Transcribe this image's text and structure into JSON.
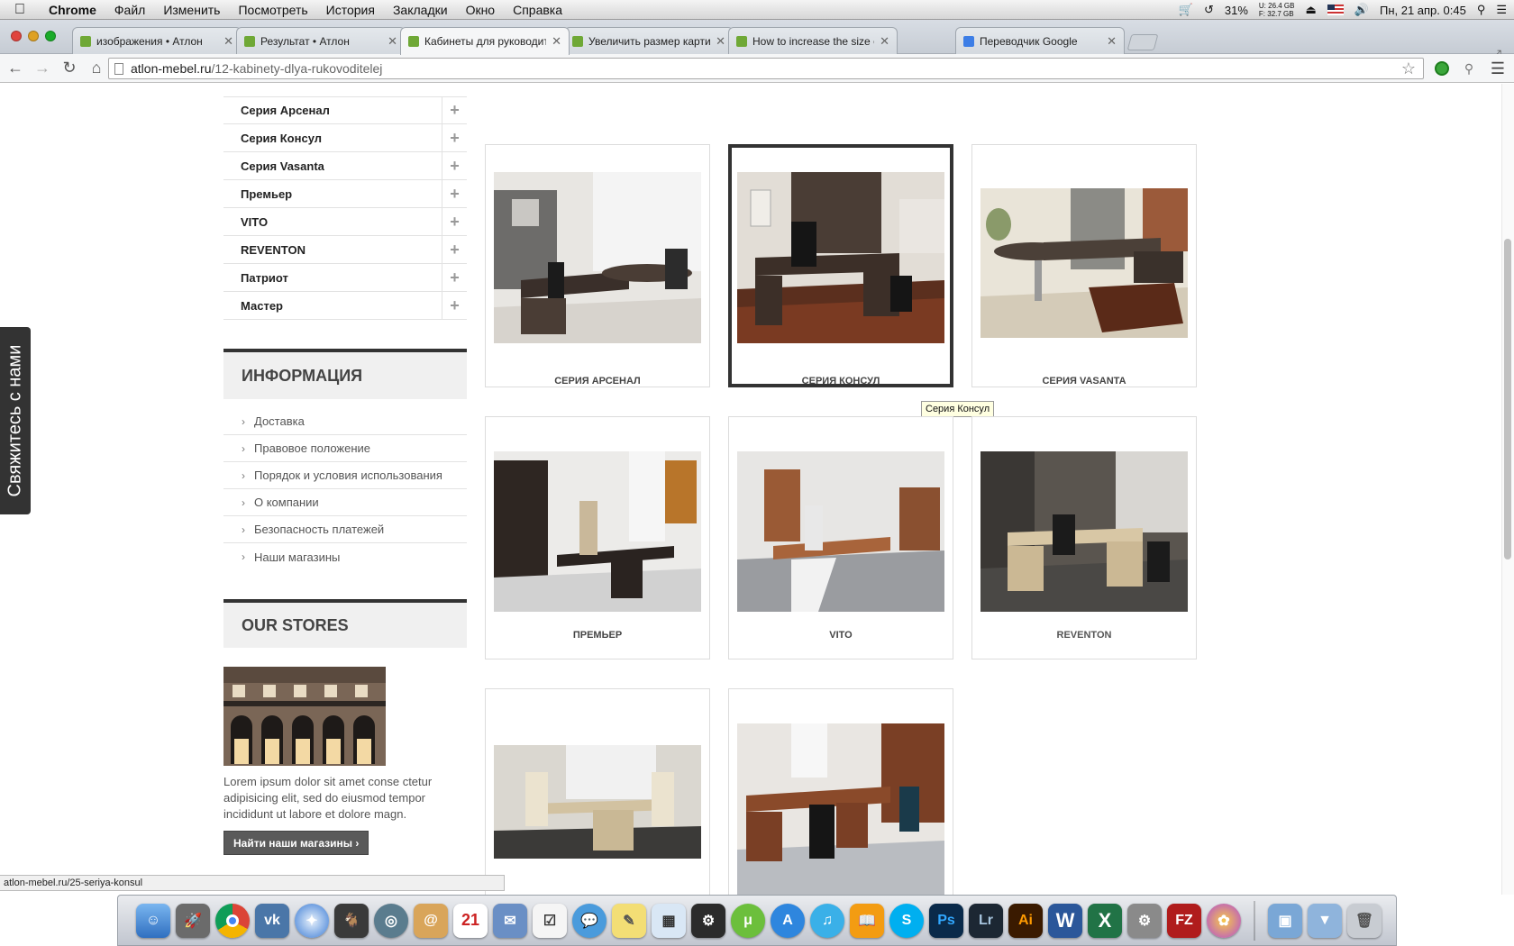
{
  "menubar": {
    "app": "Chrome",
    "items": [
      "Файл",
      "Изменить",
      "Посмотреть",
      "История",
      "Закладки",
      "Окно",
      "Справка"
    ],
    "battery": "31%",
    "mem_u": "U:  26.4 GB",
    "mem_f": "F:  32.7 GB",
    "clock": "Пн, 21 апр.  0:45"
  },
  "tabs": [
    {
      "title": "изображения • Атлон",
      "active": false
    },
    {
      "title": "Результат • Атлон",
      "active": false
    },
    {
      "title": "Кабинеты для руководите",
      "active": true
    },
    {
      "title": "Увеличить размер картин",
      "active": false
    },
    {
      "title": "How to increase the size o",
      "active": false
    },
    {
      "title": "Переводчик Google",
      "active": false
    }
  ],
  "address": {
    "host": "atlon-mebel.ru",
    "path": "/12-kabinety-dlya-rukovoditelej"
  },
  "side_tab": "Свяжитесь с нами",
  "categories": [
    "Серия Арсенал",
    "Серия Консул",
    "Серия Vasanta",
    "Премьер",
    "VITO",
    "REVENTON",
    "Патриот",
    "Мастер"
  ],
  "info": {
    "title": "ИНФОРМАЦИЯ",
    "links": [
      "Доставка",
      "Правовое положение",
      "Порядок и условия использования",
      "О компании",
      "Безопасность платежей",
      "Наши магазины"
    ]
  },
  "stores": {
    "title": "OUR STORES",
    "text": "Lorem ipsum dolor sit amet conse ctetur adipisicing elit, sed do eiusmod tempor incididunt ut labore et dolore magn.",
    "button": "Найти наши магазины"
  },
  "products": [
    {
      "caption": "СЕРИЯ АРСЕНАЛ"
    },
    {
      "caption": "СЕРИЯ КОНСУЛ"
    },
    {
      "caption": "СЕРИЯ VASANTA"
    },
    {
      "caption": "ПРЕМЬЕР"
    },
    {
      "caption": "VITO"
    },
    {
      "caption": "REVENTON"
    }
  ],
  "tooltip": "Серия Консул",
  "status_url": "atlon-mebel.ru/25-seriya-konsul",
  "colors": {
    "accent_dark": "#333333",
    "dock_ps": "#0a2a4a",
    "dock_ai": "#3a1a00",
    "dock_fz": "#b01c1c"
  },
  "dock_labels": {
    "ps": "Ps",
    "lr": "Lr",
    "ai": "Ai",
    "fz": "FZ"
  }
}
